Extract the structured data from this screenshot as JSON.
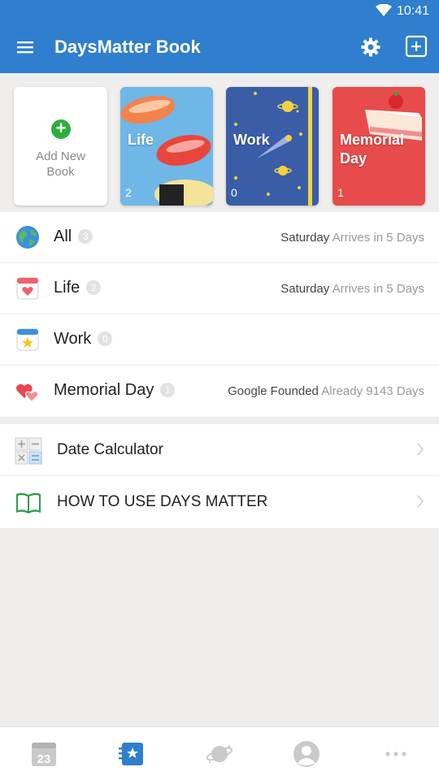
{
  "status": {
    "time": "10:41"
  },
  "appbar": {
    "title": "DaysMatter Book"
  },
  "books": {
    "add_label_line1": "Add New",
    "add_label_line2": "Book",
    "items": [
      {
        "name": "Life",
        "count": "2"
      },
      {
        "name": "Work",
        "count": "0"
      },
      {
        "name_line1": "Memorial",
        "name_line2": "Day",
        "count": "1"
      }
    ]
  },
  "categories": [
    {
      "label": "All",
      "count": "3",
      "event": "Saturday",
      "status": "Arrives in 5",
      "unit": "Days",
      "icon": "globe-icon"
    },
    {
      "label": "Life",
      "count": "2",
      "event": "Saturday",
      "status": "Arrives in 5",
      "unit": "Days",
      "icon": "heart-calendar-icon"
    },
    {
      "label": "Work",
      "count": "0",
      "icon": "star-calendar-icon"
    },
    {
      "label": "Memorial Day",
      "count": "1",
      "event": "Google Founded",
      "status": "Already 9143",
      "unit": "Days",
      "icon": "two-hearts-icon"
    }
  ],
  "tools": [
    {
      "label": "Date Calculator",
      "icon": "calculator-icon"
    },
    {
      "label": "HOW TO USE DAYS MATTER",
      "icon": "book-icon"
    }
  ],
  "tabbar": {
    "calendar_day": "23"
  },
  "colors": {
    "primary": "#2f7fce",
    "add_green": "#2eaf3b",
    "life_book": "#6fb7e6",
    "work_book": "#3a5da8",
    "memorial_book": "#e84b4b"
  }
}
